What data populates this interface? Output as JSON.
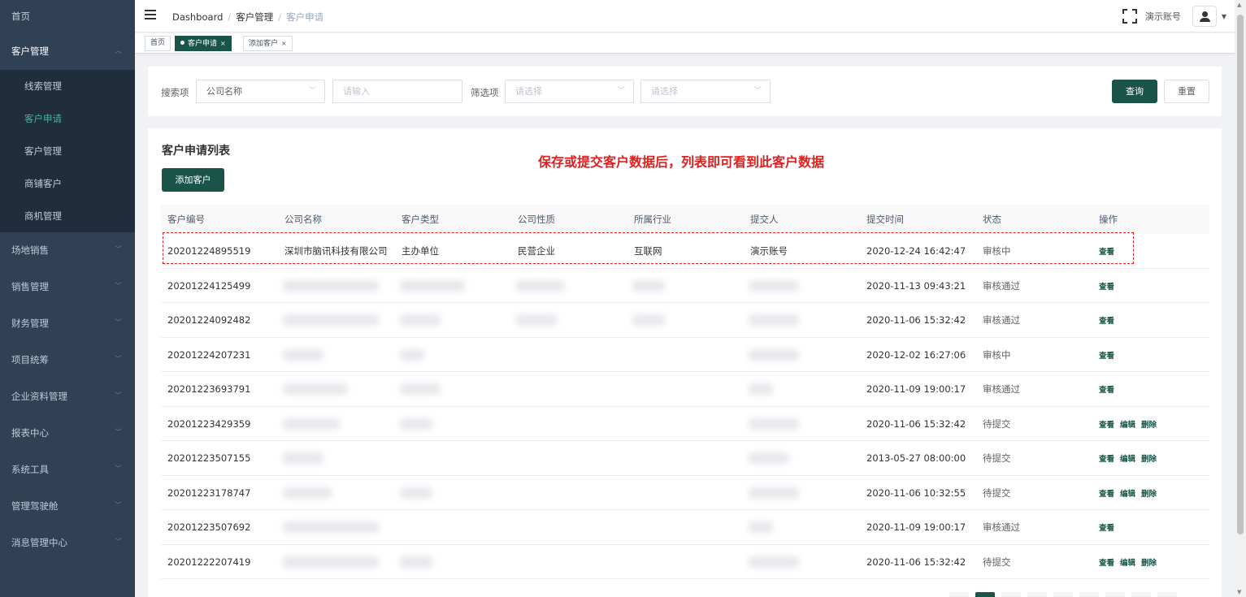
{
  "sidebar": {
    "home": "首页",
    "customer_mgmt": "客户管理",
    "sub_items": [
      "线索管理",
      "客户申请",
      "客户管理",
      "商铺客户",
      "商机管理"
    ],
    "menus": [
      "场地销售",
      "销售管理",
      "财务管理",
      "项目统筹",
      "企业资料管理",
      "报表中心",
      "系统工具",
      "管理驾驶舱",
      "消息管理中心"
    ]
  },
  "navbar": {
    "breadcrumb": [
      "Dashboard",
      "客户管理",
      "客户申请"
    ],
    "user_name": "演示账号"
  },
  "tags": [
    {
      "label": "首页"
    },
    {
      "label": "客户申请",
      "close": "×"
    },
    {
      "label": "添加客户",
      "close": "×"
    }
  ],
  "search": {
    "search_label": "搜索项",
    "search_select_value": "公司名称",
    "input_placeholder": "请输入",
    "filter_label": "筛选项",
    "filter1_placeholder": "请选择",
    "filter2_placeholder": "请选择",
    "query_button": "查询",
    "reset_button": "重置"
  },
  "list": {
    "title": "客户申请列表",
    "notice": "保存或提交客户数据后，列表即可看到此客户数据",
    "add_button": "添加客户",
    "columns": [
      "客户编号",
      "公司名称",
      "客户类型",
      "公司性质",
      "所属行业",
      "提交人",
      "提交时间",
      "状态",
      "操作"
    ],
    "rows": [
      {
        "id": "20201224895519",
        "company": "深圳市脑讯科技有限公司",
        "type": "主办单位",
        "nature": "民营企业",
        "industry": "互联网",
        "submitter": "演示账号",
        "time": "2020-12-24 16:42:47",
        "status": "审核中",
        "ops": [
          "查看"
        ]
      },
      {
        "id": "20201224125499",
        "time": "2020-11-13 09:43:21",
        "status": "审核通过",
        "ops": [
          "查看"
        ]
      },
      {
        "id": "20201224092482",
        "time": "2020-11-06 15:32:42",
        "status": "审核通过",
        "ops": [
          "查看"
        ]
      },
      {
        "id": "20201224207231",
        "time": "2020-12-02 16:27:06",
        "status": "审核中",
        "ops": [
          "查看"
        ]
      },
      {
        "id": "20201223693791",
        "time": "2020-11-09 19:00:17",
        "status": "审核通过",
        "ops": [
          "查看"
        ]
      },
      {
        "id": "20201223429359",
        "time": "2020-11-06 15:32:42",
        "status": "待提交",
        "ops": [
          "查看",
          "编辑",
          "删除"
        ]
      },
      {
        "id": "20201223507155",
        "time": "2013-05-27 08:00:00",
        "status": "待提交",
        "ops": [
          "查看",
          "编辑",
          "删除"
        ]
      },
      {
        "id": "20201223178747",
        "time": "2020-11-06 10:32:55",
        "status": "待提交",
        "ops": [
          "查看",
          "编辑",
          "删除"
        ]
      },
      {
        "id": "20201223507692",
        "time": "2020-11-09 19:00:17",
        "status": "审核通过",
        "ops": [
          "查看"
        ]
      },
      {
        "id": "20201222207419",
        "time": "2020-11-06 15:32:42",
        "status": "待提交",
        "ops": [
          "查看",
          "编辑",
          "删除"
        ]
      }
    ]
  },
  "colors": {
    "sidebar_bg": "#304156",
    "primary": "#1a5347",
    "active_menu": "#4cb19a",
    "notice_red": "#e02020"
  }
}
